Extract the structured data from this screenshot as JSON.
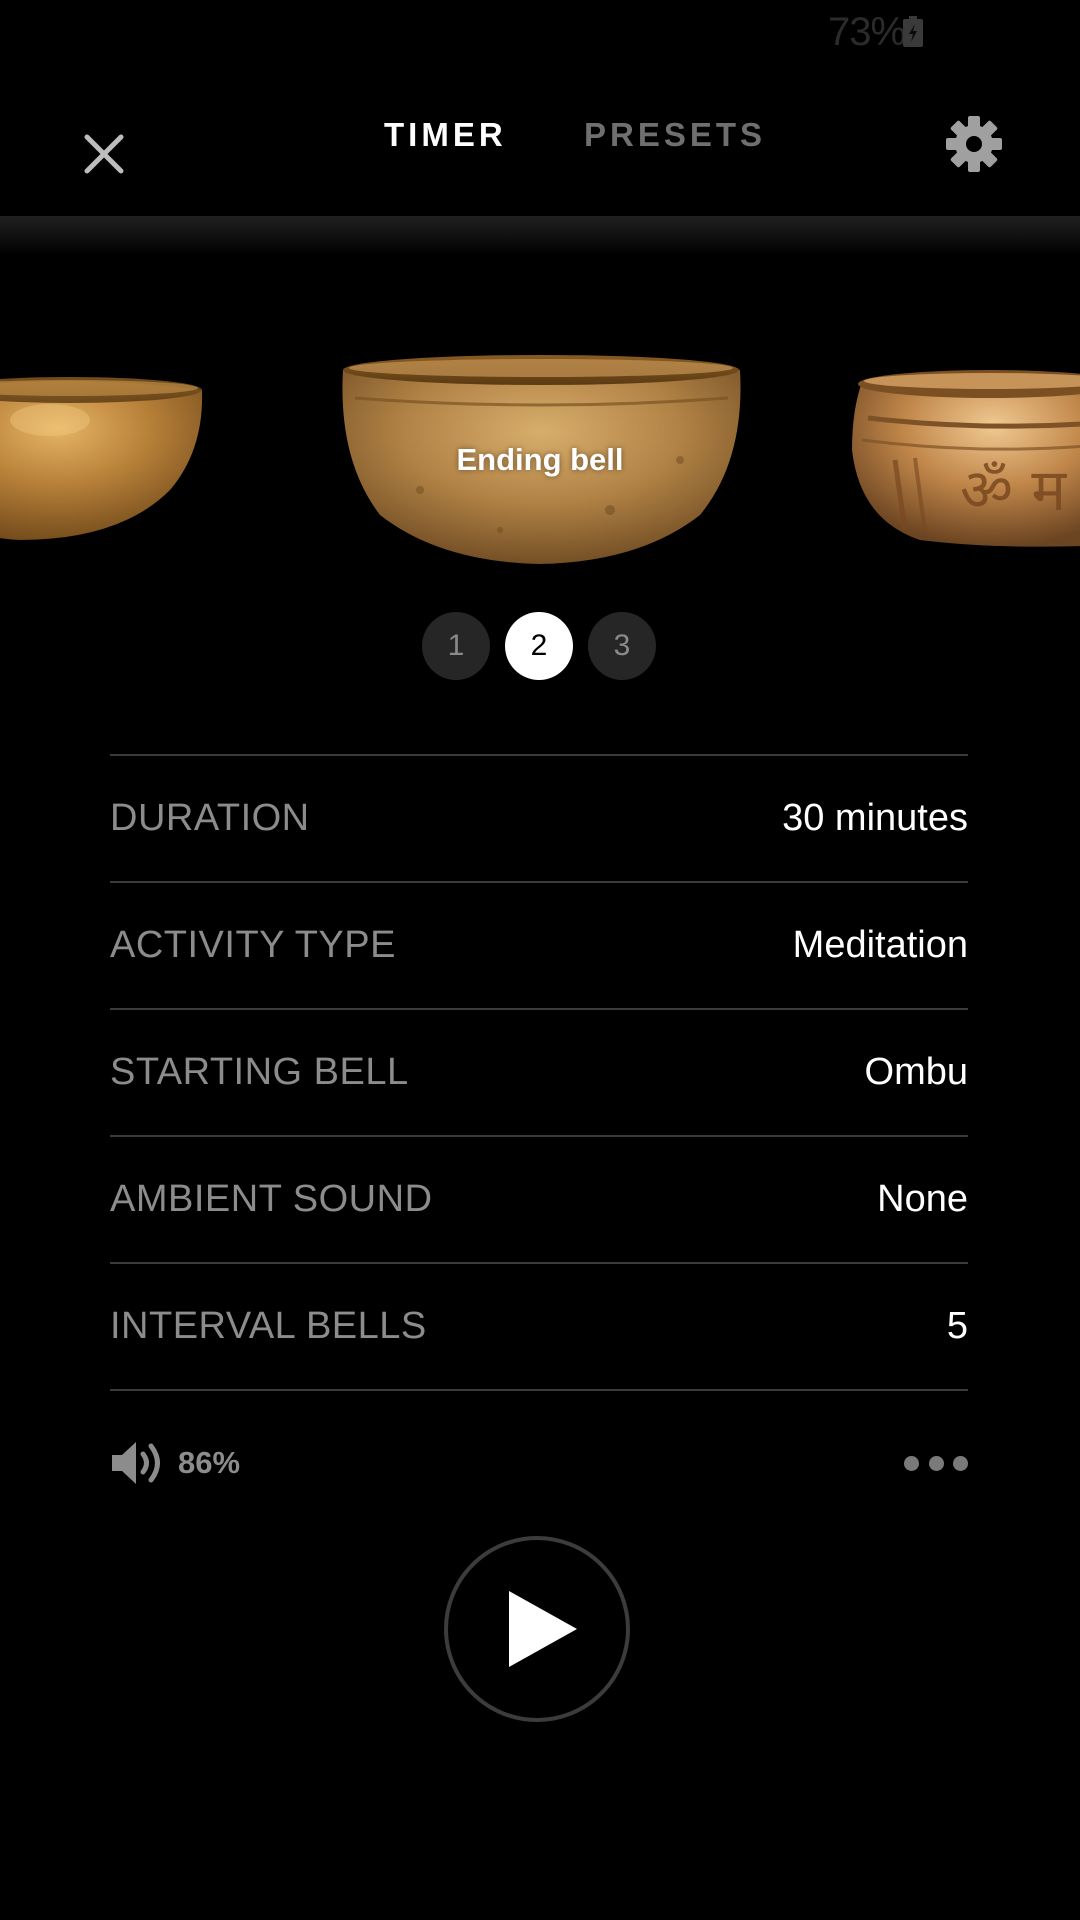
{
  "status_bar": {
    "battery_percent": "73%",
    "battery_icon": "battery-charging-icon"
  },
  "header": {
    "close_icon": "close-icon",
    "tabs": [
      {
        "label": "TIMER",
        "active": true
      },
      {
        "label": "PRESETS",
        "active": false
      }
    ],
    "settings_icon": "gear-icon"
  },
  "carousel": {
    "center_label": "Ending bell",
    "pages": [
      {
        "label": "1",
        "active": false
      },
      {
        "label": "2",
        "active": true
      },
      {
        "label": "3",
        "active": false
      }
    ]
  },
  "settings": [
    {
      "label": "DURATION",
      "value": "30 minutes"
    },
    {
      "label": "ACTIVITY TYPE",
      "value": "Meditation"
    },
    {
      "label": "STARTING BELL",
      "value": "Ombu"
    },
    {
      "label": "AMBIENT SOUND",
      "value": "None"
    },
    {
      "label": "INTERVAL BELLS",
      "value": "5"
    }
  ],
  "volume": {
    "icon": "speaker-icon",
    "level": "86%"
  },
  "more_icon": "more-dots-icon",
  "play_icon": "play-icon",
  "colors": {
    "background": "#000000",
    "active_text": "#ffffff",
    "muted_text": "#8c8c8c",
    "divider": "#3a3a3a",
    "bowl_gold": "#c08a3a"
  }
}
